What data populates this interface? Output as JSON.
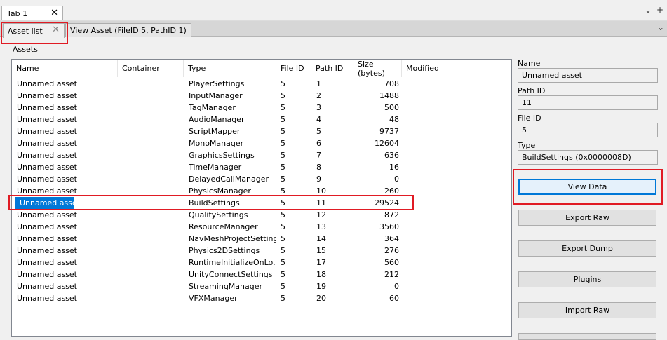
{
  "window": {
    "tab_label": "Tab 1",
    "close_glyph": "✕",
    "chevron_glyph": "⌄",
    "plus_glyph": "+"
  },
  "tabs": [
    {
      "label": "Asset list",
      "active": true
    },
    {
      "label": "View Asset (FileID 5, PathID 1)",
      "active": false
    }
  ],
  "assets_label": "Assets",
  "table": {
    "columns": [
      "Name",
      "Container",
      "Type",
      "File ID",
      "Path ID",
      "Size (bytes)",
      "Modified"
    ],
    "rows": [
      {
        "name": "Unnamed asset",
        "container": "",
        "type": "PlayerSettings",
        "file_id": "5",
        "path_id": "1",
        "size": "708",
        "modified": ""
      },
      {
        "name": "Unnamed asset",
        "container": "",
        "type": "InputManager",
        "file_id": "5",
        "path_id": "2",
        "size": "1488",
        "modified": ""
      },
      {
        "name": "Unnamed asset",
        "container": "",
        "type": "TagManager",
        "file_id": "5",
        "path_id": "3",
        "size": "500",
        "modified": ""
      },
      {
        "name": "Unnamed asset",
        "container": "",
        "type": "AudioManager",
        "file_id": "5",
        "path_id": "4",
        "size": "48",
        "modified": ""
      },
      {
        "name": "Unnamed asset",
        "container": "",
        "type": "ScriptMapper",
        "file_id": "5",
        "path_id": "5",
        "size": "9737",
        "modified": ""
      },
      {
        "name": "Unnamed asset",
        "container": "",
        "type": "MonoManager",
        "file_id": "5",
        "path_id": "6",
        "size": "12604",
        "modified": ""
      },
      {
        "name": "Unnamed asset",
        "container": "",
        "type": "GraphicsSettings",
        "file_id": "5",
        "path_id": "7",
        "size": "636",
        "modified": ""
      },
      {
        "name": "Unnamed asset",
        "container": "",
        "type": "TimeManager",
        "file_id": "5",
        "path_id": "8",
        "size": "16",
        "modified": ""
      },
      {
        "name": "Unnamed asset",
        "container": "",
        "type": "DelayedCallManager",
        "file_id": "5",
        "path_id": "9",
        "size": "0",
        "modified": ""
      },
      {
        "name": "Unnamed asset",
        "container": "",
        "type": "PhysicsManager",
        "file_id": "5",
        "path_id": "10",
        "size": "260",
        "modified": ""
      },
      {
        "name": "Unnamed asset",
        "container": "",
        "type": "BuildSettings",
        "file_id": "5",
        "path_id": "11",
        "size": "29524",
        "modified": "",
        "selected": true
      },
      {
        "name": "Unnamed asset",
        "container": "",
        "type": "QualitySettings",
        "file_id": "5",
        "path_id": "12",
        "size": "872",
        "modified": ""
      },
      {
        "name": "Unnamed asset",
        "container": "",
        "type": "ResourceManager",
        "file_id": "5",
        "path_id": "13",
        "size": "3560",
        "modified": ""
      },
      {
        "name": "Unnamed asset",
        "container": "",
        "type": "NavMeshProjectSettings",
        "file_id": "5",
        "path_id": "14",
        "size": "364",
        "modified": ""
      },
      {
        "name": "Unnamed asset",
        "container": "",
        "type": "Physics2DSettings",
        "file_id": "5",
        "path_id": "15",
        "size": "276",
        "modified": ""
      },
      {
        "name": "Unnamed asset",
        "container": "",
        "type": "RuntimeInitializeOnLo...",
        "file_id": "5",
        "path_id": "17",
        "size": "560",
        "modified": ""
      },
      {
        "name": "Unnamed asset",
        "container": "",
        "type": "UnityConnectSettings",
        "file_id": "5",
        "path_id": "18",
        "size": "212",
        "modified": ""
      },
      {
        "name": "Unnamed asset",
        "container": "",
        "type": "StreamingManager",
        "file_id": "5",
        "path_id": "19",
        "size": "0",
        "modified": ""
      },
      {
        "name": "Unnamed asset",
        "container": "",
        "type": "VFXManager",
        "file_id": "5",
        "path_id": "20",
        "size": "60",
        "modified": ""
      }
    ]
  },
  "details": {
    "name_label": "Name",
    "name_value": "Unnamed asset",
    "path_id_label": "Path ID",
    "path_id_value": "11",
    "file_id_label": "File ID",
    "file_id_value": "5",
    "type_label": "Type",
    "type_value": "BuildSettings (0x0000008D)"
  },
  "buttons": {
    "view_data": "View Data",
    "export_raw": "Export Raw",
    "export_dump": "Export Dump",
    "plugins": "Plugins",
    "import_raw": "Import Raw"
  },
  "colors": {
    "highlight": "#e01b24",
    "selection": "#0078d7"
  }
}
